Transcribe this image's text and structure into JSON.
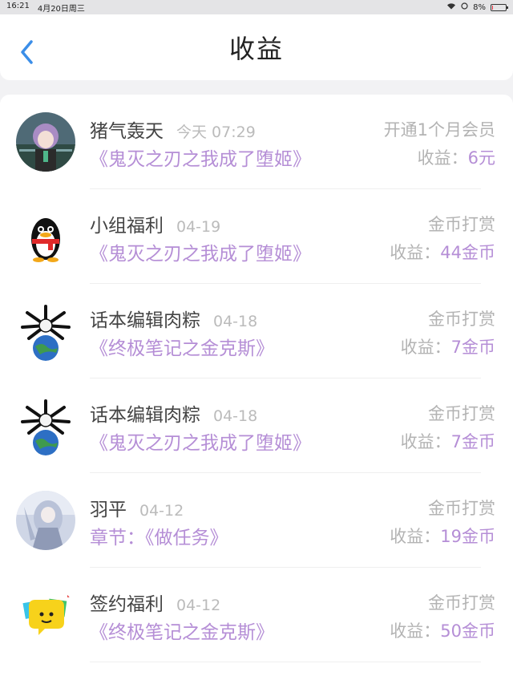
{
  "status_bar": {
    "time": "16:21",
    "date": "4月20日周三",
    "battery": "8%",
    "battery_level": 0.08
  },
  "header": {
    "title": "收益"
  },
  "items": [
    {
      "name": "猪气轰天",
      "date": "今天 07:29",
      "type": "开通1个月会员",
      "book": "《鬼灭之刃之我成了堕姬》",
      "earn_label": "收益：",
      "earn_value": "6元"
    },
    {
      "name": "小组福利",
      "date": "04-19",
      "type": "金币打赏",
      "book": "《鬼灭之刃之我成了堕姬》",
      "earn_label": "收益：",
      "earn_value": "44金币"
    },
    {
      "name": "话本编辑肉粽",
      "date": "04-18",
      "type": "金币打赏",
      "book": "《终极笔记之金克斯》",
      "earn_label": "收益：",
      "earn_value": "7金币"
    },
    {
      "name": "话本编辑肉粽",
      "date": "04-18",
      "type": "金币打赏",
      "book": "《鬼灭之刃之我成了堕姬》",
      "earn_label": "收益：",
      "earn_value": "7金币"
    },
    {
      "name": "羽平",
      "date": "04-12",
      "type": "金币打赏",
      "book": "章节：《做任务》",
      "earn_label": "收益：",
      "earn_value": "19金币"
    },
    {
      "name": "签约福利",
      "date": "04-12",
      "type": "金币打赏",
      "book": "《终极笔记之金克斯》",
      "earn_label": "收益：",
      "earn_value": "50金币"
    }
  ],
  "colors": {
    "accent_purple": "#b58ed6",
    "back_blue": "#3b8ee8",
    "muted_gray": "#b3b3b3"
  },
  "icons": {
    "back": "chevron-left-icon",
    "wifi": "wifi-icon",
    "battery": "battery-icon"
  }
}
